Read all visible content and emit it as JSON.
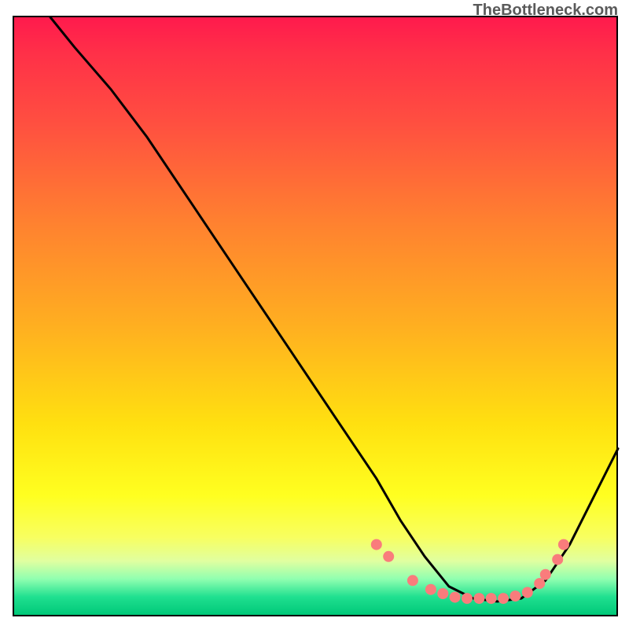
{
  "watermark": "TheBottleneck.com",
  "chart_data": {
    "type": "line",
    "title": "",
    "xlabel": "",
    "ylabel": "",
    "xlim": [
      0,
      100
    ],
    "ylim": [
      0,
      100
    ],
    "note": "V-shaped bottleneck curve over red-to-green vertical gradient; minimum plateau around x≈72–86 at y≈3; scattered pink points hug the plateau region.",
    "series": [
      {
        "name": "curve",
        "x": [
          6,
          10,
          16,
          22,
          30,
          38,
          46,
          54,
          60,
          64,
          68,
          72,
          76,
          80,
          84,
          88,
          92,
          96,
          100
        ],
        "y": [
          100,
          95,
          88,
          80,
          68,
          56,
          44,
          32,
          23,
          16,
          10,
          5,
          3,
          2.5,
          3,
          6,
          12,
          20,
          28
        ]
      }
    ],
    "points": {
      "name": "highlight-dots",
      "x": [
        60,
        62,
        66,
        69,
        71,
        73,
        75,
        77,
        79,
        81,
        83,
        85,
        87,
        88,
        90,
        91
      ],
      "y": [
        12,
        10,
        6,
        4.5,
        3.8,
        3.2,
        3,
        3,
        3,
        3,
        3.4,
        4,
        5.5,
        7,
        9.5,
        12
      ]
    }
  }
}
